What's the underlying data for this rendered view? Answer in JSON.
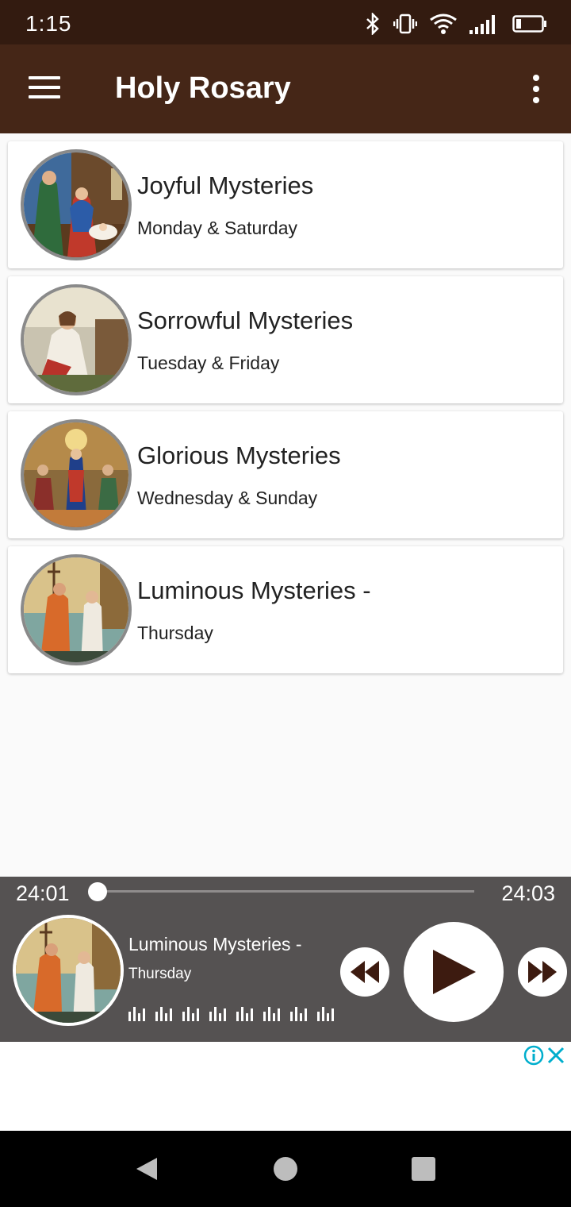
{
  "status_bar": {
    "time": "1:15",
    "icons": [
      "bluetooth-icon",
      "vibrate-icon",
      "wifi-icon",
      "signal-icon",
      "battery-icon"
    ]
  },
  "app_bar": {
    "title": "Holy Rosary",
    "menu_icon": "hamburger-menu-icon",
    "overflow_icon": "more-vert-icon"
  },
  "mysteries": [
    {
      "title": "Joyful Mysteries",
      "days": "Monday & Saturday",
      "image": "nativity-painting"
    },
    {
      "title": "Sorrowful Mysteries",
      "days": "Tuesday & Friday",
      "image": "agony-in-garden-painting"
    },
    {
      "title": "Glorious Mysteries",
      "days": "Wednesday & Sunday",
      "image": "pentecost-painting"
    },
    {
      "title": "Luminous Mysteries -",
      "days": "Thursday",
      "image": "baptism-painting"
    }
  ],
  "player": {
    "elapsed": "24:01",
    "duration": "24:03",
    "progress_fraction": 0.0,
    "title": "Luminous Mysteries -",
    "subtitle": "Thursday",
    "image": "baptism-painting"
  },
  "colors": {
    "status_bar": "#331b10",
    "app_bar": "#452617",
    "player_bg": "#555252",
    "accent": "#3d1b10",
    "ad_icon": "#00aecd"
  }
}
